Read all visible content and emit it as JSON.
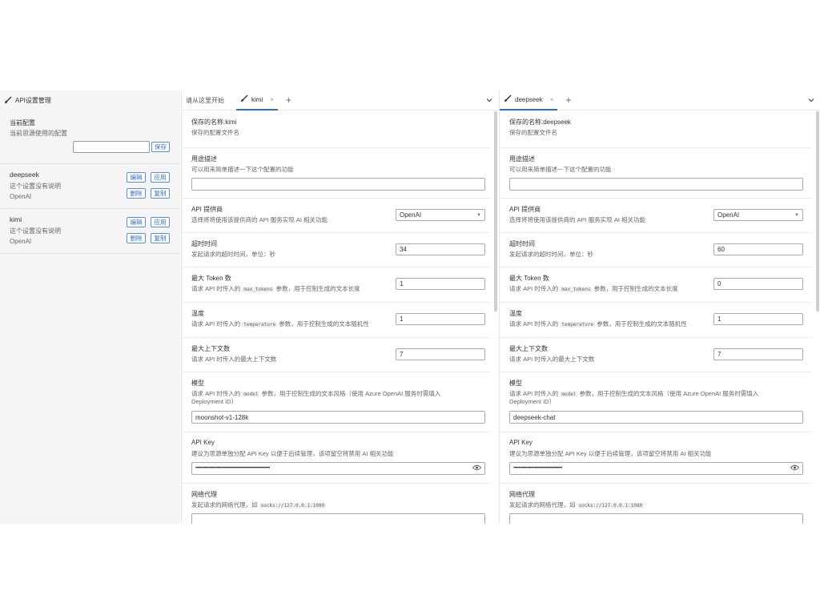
{
  "left": {
    "header_title": "API设置管理",
    "current_label": "当前配置",
    "current_desc": "当前思源使用的配置",
    "current_value": "",
    "save_label": "保存",
    "configs": [
      {
        "name": "deepseek",
        "desc": "这个设置没有说明",
        "provider": "OpenAI",
        "edit": "编辑",
        "apply": "应用",
        "delete": "删除",
        "copy": "复制"
      },
      {
        "name": "kimi",
        "desc": "这个设置没有说明",
        "provider": "OpenAI",
        "edit": "编辑",
        "apply": "应用",
        "delete": "删除",
        "copy": "复制"
      }
    ]
  },
  "pane1": {
    "start_tab": "请从这里开始",
    "active_tab": "kimi",
    "close": "×",
    "plus": "+",
    "saved_name_label": "保存的名称:kimi",
    "saved_name_desc": "保存的配置文件名",
    "purpose_label": "用途描述",
    "purpose_desc": "可以用来简单描述一下这个配置的功能",
    "purpose_value": "",
    "provider_label": "API 提供商",
    "provider_desc": "选择将将使用该提供商的 API 服务实现 AI 相关功能",
    "provider_value": "OpenAI",
    "timeout_label": "超时时间",
    "timeout_desc": "发起请求的超时时间，单位：秒",
    "timeout_value": "34",
    "maxtoken_label": "最大 Token 数",
    "maxtoken_desc_a": "请求 API 时传入的",
    "maxtoken_code": "max_tokens",
    "maxtoken_desc_b": "参数，用于控制生成的文本长度",
    "maxtoken_value": "1",
    "temp_label": "温度",
    "temp_desc_a": "请求 API 时传入的",
    "temp_code": "temperature",
    "temp_desc_b": "参数，用于控制生成的文本随机性",
    "temp_value": "1",
    "ctx_label": "最大上下文数",
    "ctx_desc": "请求 API 时传入的最大上下文数",
    "ctx_value": "7",
    "model_label": "模型",
    "model_desc_a": "请求 API 时传入的",
    "model_code": "model",
    "model_desc_b": "参数，用于控制生成的文本风格（使用 Azure OpenAI 服务时需填入",
    "model_desc_c": "Deployment ID）",
    "model_value": "moonshot-v1-128k",
    "key_label": "API Key",
    "key_desc": "建议为思源单独分配 API Key 以便于后续管理，该项留空将禁用 AI 相关功能",
    "key_value": "••••••••••••••••••••••••••••••••••••••••••••••••••••••••••",
    "proxy_label": "网络代理",
    "proxy_desc_a": "发起请求的网络代理，如",
    "proxy_code": "socks://127.0.0.1:1080",
    "proxy_value": ""
  },
  "pane2": {
    "active_tab": "deepseek",
    "close": "×",
    "plus": "+",
    "saved_name_label": "保存的名称:deepseek",
    "saved_name_desc": "保存的配置文件名",
    "purpose_label": "用途描述",
    "purpose_desc": "可以用来简单描述一下这个配置的功能",
    "purpose_value": "",
    "provider_label": "API 提供商",
    "provider_desc": "选择将将使用该提供商的 API 服务实现 AI 相关功能",
    "provider_value": "OpenAI",
    "timeout_label": "超时时间",
    "timeout_desc": "发起请求的超时时间，单位：秒",
    "timeout_value": "60",
    "maxtoken_label": "最大 Token 数",
    "maxtoken_desc_a": "请求 API 时传入的",
    "maxtoken_code": "max_tokens",
    "maxtoken_desc_b": "参数，用于控制生成的文本长度",
    "maxtoken_value": "0",
    "temp_label": "温度",
    "temp_desc_a": "请求 API 时传入的",
    "temp_code": "temperature",
    "temp_desc_b": "参数，用于控制生成的文本随机性",
    "temp_value": "1",
    "ctx_label": "最大上下文数",
    "ctx_desc": "请求 API 时传入的最大上下文数",
    "ctx_value": "7",
    "model_label": "模型",
    "model_desc_a": "请求 API 时传入的",
    "model_code": "model",
    "model_desc_b": "参数，用于控制生成的文本风格（使用 Azure OpenAI 服务时需填入",
    "model_desc_c": "Deployment ID）",
    "model_value": "deepseek-chat",
    "key_label": "API Key",
    "key_desc": "建议为思源单独分配 API Key 以便于后续管理，该项留空将禁用 AI 相关功能",
    "key_value": "••••••••••••••••••••••••••••••••••••••",
    "proxy_label": "网络代理",
    "proxy_desc_a": "发起请求的网络代理，如",
    "proxy_code": "socks://127.0.0.1:1080",
    "proxy_value": ""
  }
}
